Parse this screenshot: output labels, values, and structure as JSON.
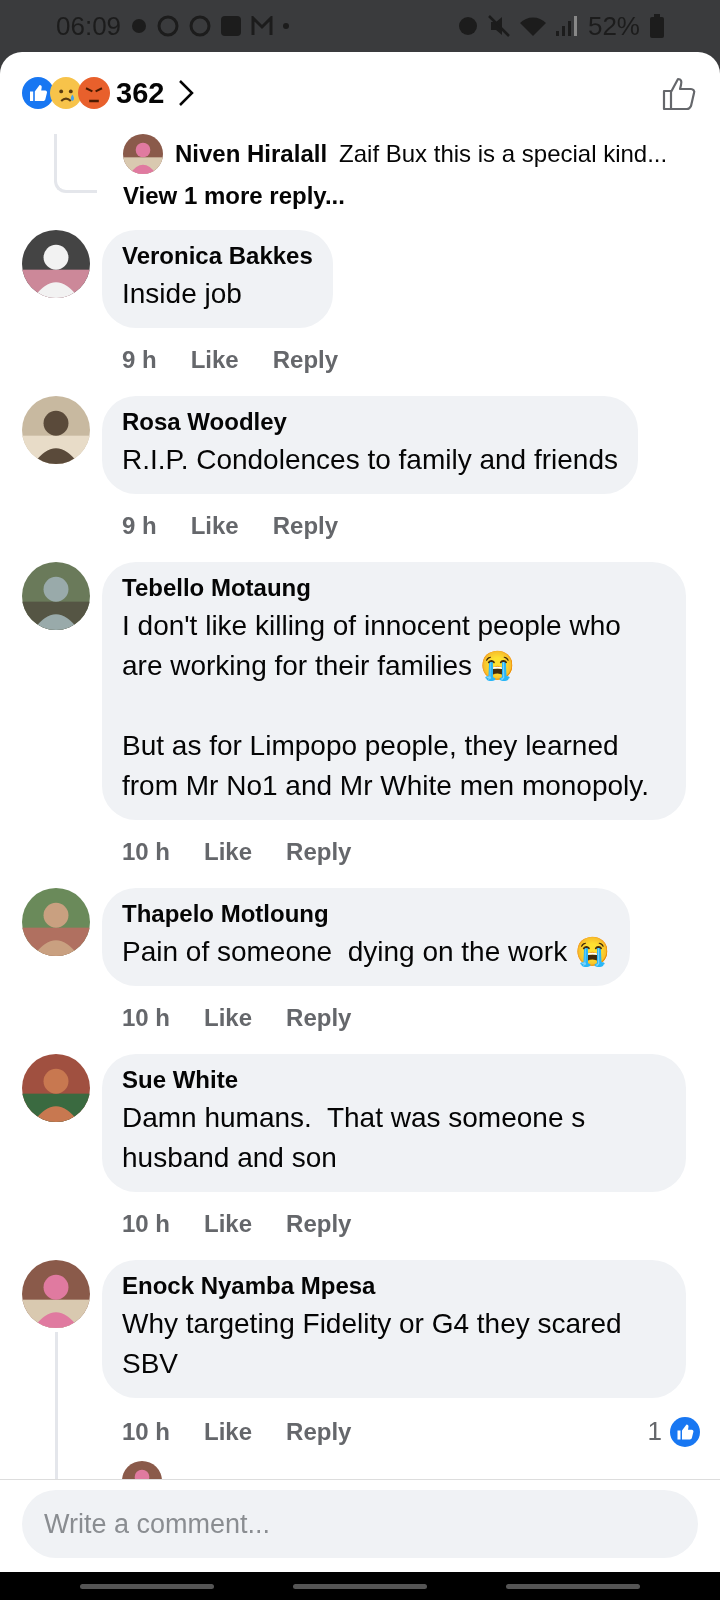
{
  "status_bar": {
    "time": "06:09",
    "battery": "52%"
  },
  "header": {
    "reaction_count": "362"
  },
  "reply_preview": {
    "name": "Niven Hiralall",
    "text": "Zaif Bux this is a special kind...",
    "more": "View 1 more reply..."
  },
  "comments": [
    {
      "name": "Veronica Bakkes",
      "text": "Inside job",
      "time": "9 h",
      "like": "Like",
      "reply": "Reply",
      "thread": false
    },
    {
      "name": "Rosa Woodley",
      "text": "R.I.P. Condolences to family and friends",
      "time": "9 h",
      "like": "Like",
      "reply": "Reply",
      "thread": false
    },
    {
      "name": "Tebello Motaung",
      "text": "I don't like killing of innocent people who are working for their families 😭\n\nBut as for Limpopo people, they learned from Mr No1 and Mr White men monopoly.",
      "time": "10 h",
      "like": "Like",
      "reply": "Reply",
      "thread": false
    },
    {
      "name": "Thapelo Motloung",
      "text": "Pain of someone  dying on the work 😭",
      "time": "10 h",
      "like": "Like",
      "reply": "Reply",
      "thread": false
    },
    {
      "name": "Sue White",
      "text": "Damn humans.  That was someone s husband and son",
      "time": "10 h",
      "like": "Like",
      "reply": "Reply",
      "thread": false
    },
    {
      "name": "Enock Nyamba Mpesa",
      "text": "Why targeting Fidelity or G4 they scared SBV",
      "time": "10 h",
      "like": "Like",
      "reply": "Reply",
      "thread": true,
      "like_count": "1"
    }
  ],
  "composer": {
    "placeholder": "Write a comment..."
  }
}
